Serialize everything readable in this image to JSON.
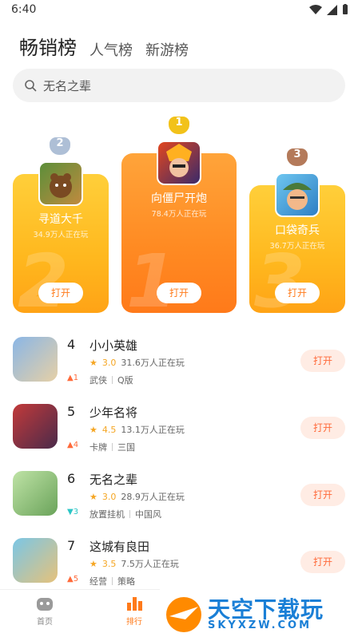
{
  "status": {
    "time": "6:40"
  },
  "tabs": [
    {
      "label": "畅销榜"
    },
    {
      "label": "人气榜"
    },
    {
      "label": "新游榜"
    }
  ],
  "search": {
    "placeholder": "无名之辈"
  },
  "podium": [
    {
      "rank": "2",
      "name": "寻道大千",
      "players": "34.9万人正在玩",
      "open": "打开"
    },
    {
      "rank": "1",
      "name": "向僵尸开炮",
      "players": "78.4万人正在玩",
      "open": "打开"
    },
    {
      "rank": "3",
      "name": "口袋奇兵",
      "players": "36.7万人正在玩",
      "open": "打开"
    }
  ],
  "list": [
    {
      "rank": "4",
      "title": "小小英雄",
      "score": "3.0",
      "players": "31.6万人正在玩",
      "tags": [
        "武侠",
        "Q版"
      ],
      "trend": "1",
      "trend_dir": "up",
      "btn": "打开"
    },
    {
      "rank": "5",
      "title": "少年名将",
      "score": "4.5",
      "players": "13.1万人正在玩",
      "tags": [
        "卡牌",
        "三国"
      ],
      "trend": "4",
      "trend_dir": "up",
      "btn": "打开"
    },
    {
      "rank": "6",
      "title": "无名之辈",
      "score": "3.0",
      "players": "28.9万人正在玩",
      "tags": [
        "放置挂机",
        "中国风"
      ],
      "trend": "3",
      "trend_dir": "down",
      "btn": "打开"
    },
    {
      "rank": "7",
      "title": "这城有良田",
      "score": "3.5",
      "players": "7.5万人正在玩",
      "tags": [
        "经营",
        "策略"
      ],
      "trend": "5",
      "trend_dir": "up",
      "btn": "打开"
    }
  ],
  "nav": [
    {
      "label": "首页"
    },
    {
      "label": "排行"
    }
  ],
  "watermark": {
    "cn": "天空下载玩",
    "en": "SKYXZW.COM"
  },
  "colors": {
    "accent": "#ff7a1a",
    "gold": "#ffb81e",
    "star": "#f5a623"
  }
}
